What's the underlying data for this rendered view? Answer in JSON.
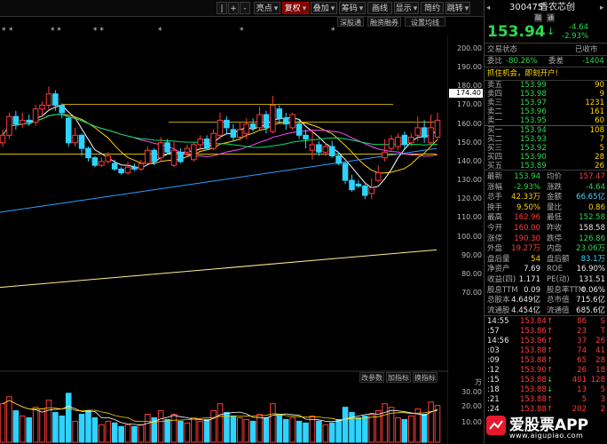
{
  "toolbar": {
    "left_icons": [
      "|",
      "+",
      "-"
    ],
    "buttons": [
      {
        "label": "亮点",
        "arrow": "▾",
        "active": false
      },
      {
        "label": "复权",
        "arrow": "▾",
        "active": true
      },
      {
        "label": "叠加",
        "arrow": "▾",
        "active": false
      },
      {
        "label": "筹码",
        "arrow": "▾",
        "active": false
      },
      {
        "label": "画线",
        "arrow": "",
        "active": false
      },
      {
        "label": "显示",
        "arrow": "▾",
        "active": false
      },
      {
        "label": "简约",
        "arrow": "",
        "active": false
      },
      {
        "label": "跳转",
        "arrow": "▾",
        "active": false
      }
    ],
    "sub_buttons": [
      "深股通",
      "融资融券",
      "设置均线"
    ]
  },
  "chart": {
    "price_axis_labels": [
      "200.00",
      "190.00",
      "180.00",
      "170.00",
      "160.00",
      "150.00",
      "140.00",
      "130.00",
      "120.00",
      "110.00",
      "100.00",
      "90.00",
      "80.00",
      "70.00"
    ],
    "current_price_tag": "174.40",
    "volume_toolbar": [
      "改参数",
      "加指标",
      "换指标"
    ],
    "volume_axis_labels": [
      "万",
      "30.00",
      "20.00",
      "10.00"
    ],
    "colors": {
      "up": "#ff3b3b",
      "down": "#2fd3ff",
      "ma5": "#ffffff",
      "ma10": "#ffd400",
      "ma20": "#ff4cff",
      "ma60": "#00e36a",
      "ma120": "#2aa0ff",
      "ma250": "#fff08a"
    }
  },
  "chart_data": {
    "type": "candlestick",
    "ylim": [
      70,
      200
    ],
    "candles": [
      {
        "o": 150,
        "c": 154,
        "h": 157,
        "l": 148
      },
      {
        "o": 154,
        "c": 164,
        "h": 166,
        "l": 152
      },
      {
        "o": 164,
        "c": 160,
        "h": 167,
        "l": 157
      },
      {
        "o": 160,
        "c": 162,
        "h": 166,
        "l": 158
      },
      {
        "o": 162,
        "c": 161,
        "h": 165,
        "l": 159
      },
      {
        "o": 161,
        "c": 168,
        "h": 170,
        "l": 159
      },
      {
        "o": 168,
        "c": 170,
        "h": 172,
        "l": 164
      },
      {
        "o": 170,
        "c": 176,
        "h": 180,
        "l": 168
      },
      {
        "o": 176,
        "c": 170,
        "h": 178,
        "l": 167
      },
      {
        "o": 170,
        "c": 166,
        "h": 171,
        "l": 163
      },
      {
        "o": 163,
        "c": 150,
        "h": 164,
        "l": 148
      },
      {
        "o": 150,
        "c": 154,
        "h": 158,
        "l": 148
      },
      {
        "o": 154,
        "c": 147,
        "h": 155,
        "l": 143
      },
      {
        "o": 147,
        "c": 142,
        "h": 148,
        "l": 140
      },
      {
        "o": 142,
        "c": 138,
        "h": 143,
        "l": 137
      },
      {
        "o": 138,
        "c": 140,
        "h": 142,
        "l": 137
      },
      {
        "o": 140,
        "c": 143,
        "h": 145,
        "l": 139
      },
      {
        "o": 139,
        "c": 136,
        "h": 141,
        "l": 135
      },
      {
        "o": 136,
        "c": 134,
        "h": 137,
        "l": 133
      },
      {
        "o": 134,
        "c": 137,
        "h": 140,
        "l": 133
      },
      {
        "o": 137,
        "c": 136,
        "h": 139,
        "l": 135
      },
      {
        "o": 136,
        "c": 139,
        "h": 141,
        "l": 135
      },
      {
        "o": 139,
        "c": 146,
        "h": 148,
        "l": 139
      },
      {
        "o": 146,
        "c": 140,
        "h": 147,
        "l": 138
      },
      {
        "o": 142,
        "c": 150,
        "h": 153,
        "l": 140
      },
      {
        "o": 150,
        "c": 145,
        "h": 152,
        "l": 144
      },
      {
        "o": 138,
        "c": 146,
        "h": 151,
        "l": 137
      },
      {
        "o": 145,
        "c": 140,
        "h": 147,
        "l": 139
      },
      {
        "o": 145,
        "c": 147,
        "h": 149,
        "l": 143
      },
      {
        "o": 141,
        "c": 149,
        "h": 150,
        "l": 140
      },
      {
        "o": 149,
        "c": 152,
        "h": 154,
        "l": 146
      },
      {
        "o": 152,
        "c": 147,
        "h": 154,
        "l": 146
      },
      {
        "o": 147,
        "c": 155,
        "h": 157,
        "l": 146
      },
      {
        "o": 154,
        "c": 162,
        "h": 166,
        "l": 152
      },
      {
        "o": 162,
        "c": 158,
        "h": 164,
        "l": 155
      },
      {
        "o": 157,
        "c": 153,
        "h": 160,
        "l": 151
      },
      {
        "o": 153,
        "c": 157,
        "h": 161,
        "l": 151
      },
      {
        "o": 155,
        "c": 160,
        "h": 163,
        "l": 152
      },
      {
        "o": 160,
        "c": 158,
        "h": 163,
        "l": 156
      },
      {
        "o": 158,
        "c": 165,
        "h": 169,
        "l": 157
      },
      {
        "o": 165,
        "c": 158,
        "h": 167,
        "l": 155
      },
      {
        "o": 156,
        "c": 170,
        "h": 175,
        "l": 155
      },
      {
        "o": 168,
        "c": 163,
        "h": 170,
        "l": 160
      },
      {
        "o": 163,
        "c": 160,
        "h": 166,
        "l": 157
      },
      {
        "o": 158,
        "c": 165,
        "h": 166,
        "l": 157
      },
      {
        "o": 160,
        "c": 154,
        "h": 162,
        "l": 152
      },
      {
        "o": 154,
        "c": 152,
        "h": 157,
        "l": 147
      },
      {
        "o": 146,
        "c": 149,
        "h": 157,
        "l": 141
      },
      {
        "o": 149,
        "c": 145,
        "h": 151,
        "l": 143
      },
      {
        "o": 145,
        "c": 148,
        "h": 150,
        "l": 143
      },
      {
        "o": 148,
        "c": 143,
        "h": 151,
        "l": 142
      },
      {
        "o": 143,
        "c": 139,
        "h": 145,
        "l": 138
      },
      {
        "o": 139,
        "c": 130,
        "h": 140,
        "l": 128
      },
      {
        "o": 130,
        "c": 125,
        "h": 133,
        "l": 124
      },
      {
        "o": 128,
        "c": 127,
        "h": 130,
        "l": 126
      },
      {
        "o": 127,
        "c": 122,
        "h": 128,
        "l": 120
      },
      {
        "o": 123,
        "c": 126,
        "h": 131,
        "l": 120
      },
      {
        "o": 130,
        "c": 134,
        "h": 138,
        "l": 129
      },
      {
        "o": 142,
        "c": 145,
        "h": 152,
        "l": 140
      },
      {
        "o": 147,
        "c": 152,
        "h": 154,
        "l": 145
      },
      {
        "o": 148,
        "c": 153,
        "h": 155,
        "l": 146
      },
      {
        "o": 154,
        "c": 149,
        "h": 156,
        "l": 147
      },
      {
        "o": 150,
        "c": 153,
        "h": 155,
        "l": 148
      },
      {
        "o": 154,
        "c": 158,
        "h": 164,
        "l": 151
      },
      {
        "o": 158,
        "c": 153,
        "h": 162,
        "l": 150
      },
      {
        "o": 150,
        "c": 158,
        "h": 165,
        "l": 149
      },
      {
        "o": 153,
        "c": 162,
        "h": 166,
        "l": 151
      }
    ],
    "volumes": [
      22,
      26,
      18,
      15,
      14,
      20,
      19,
      24,
      17,
      15,
      28,
      12,
      16,
      18,
      14,
      10,
      12,
      11,
      9,
      10,
      9,
      10,
      16,
      14,
      18,
      13,
      16,
      12,
      11,
      14,
      12,
      13,
      18,
      22,
      17,
      15,
      14,
      13,
      12,
      16,
      14,
      22,
      16,
      13,
      14,
      12,
      11,
      15,
      12,
      10,
      11,
      13,
      20,
      17,
      14,
      15,
      16,
      18,
      22,
      20,
      14,
      13,
      15,
      19,
      16,
      23,
      21
    ]
  },
  "quote": {
    "code": "300475",
    "name": "香农芯创",
    "badges": [
      "融",
      "通"
    ],
    "price": "153.94",
    "arrow": "↓",
    "change": "-4.64",
    "change_pct": "-2.93%",
    "section_title": "交易状态",
    "status": "已收市",
    "weibi_label": "委比",
    "weibi": "-80.26%",
    "weicha_label": "委差",
    "weicha": "-1404",
    "ad_text": "抓住机会，即刻开户!",
    "sells": [
      {
        "label": "卖五",
        "price": "153.99",
        "vol": "90"
      },
      {
        "label": "卖四",
        "price": "153.98",
        "vol": "9"
      },
      {
        "label": "卖三",
        "price": "153.97",
        "vol": "1231"
      },
      {
        "label": "卖二",
        "price": "153.96",
        "vol": "161"
      },
      {
        "label": "卖一",
        "price": "153.95",
        "vol": "60"
      }
    ],
    "buys": [
      {
        "label": "买一",
        "price": "153.94",
        "vol": "108"
      },
      {
        "label": "买二",
        "price": "153.93",
        "vol": "7"
      },
      {
        "label": "买三",
        "price": "153.92",
        "vol": "5"
      },
      {
        "label": "买四",
        "price": "153.90",
        "vol": "28"
      },
      {
        "label": "买五",
        "price": "153.89",
        "vol": "26"
      }
    ],
    "stats": [
      {
        "l1": "最新",
        "v1": "153.94",
        "c1": "green",
        "l2": "均价",
        "v2": "157.47",
        "c2": "red"
      },
      {
        "l1": "涨幅",
        "v1": "-2.93%",
        "c1": "green",
        "l2": "涨跌",
        "v2": "-4.64",
        "c2": "green"
      },
      {
        "l1": "总手",
        "v1": "42.33万",
        "c1": "yellow",
        "l2": "金额",
        "v2": "66.65亿",
        "c2": "cyan"
      },
      {
        "l1": "换手",
        "v1": "9.50%",
        "c1": "yellow",
        "l2": "量比",
        "v2": "0.86",
        "c2": "yellow"
      },
      {
        "l1": "最高",
        "v1": "162.96",
        "c1": "red",
        "l2": "最低",
        "v2": "152.58",
        "c2": "green"
      },
      {
        "l1": "今开",
        "v1": "160.00",
        "c1": "red",
        "l2": "昨收",
        "v2": "158.58",
        "c2": "white"
      },
      {
        "l1": "涨停",
        "v1": "190.30",
        "c1": "red",
        "l2": "跌停",
        "v2": "126.86",
        "c2": "green"
      },
      {
        "l1": "外盘",
        "v1": "19.27万",
        "c1": "red",
        "l2": "内盘",
        "v2": "23.06万",
        "c2": "green"
      },
      {
        "l1": "盘后量",
        "v1": "54",
        "c1": "yellow",
        "l2": "盘后额",
        "v2": "83.1万",
        "c2": "cyan"
      },
      {
        "l1": "净资产",
        "v1": "7.69",
        "c1": "white",
        "l2": "ROE",
        "v2": "16.90%",
        "c2": "white"
      },
      {
        "l1": "收益(四)",
        "v1": "1.171",
        "c1": "white",
        "l2": "PE(动)",
        "v2": "131.51",
        "c2": "white"
      },
      {
        "l1": "股息TTM",
        "v1": "0.09",
        "c1": "white",
        "l2": "股息率TTM",
        "v2": "0.06%",
        "c2": "white"
      },
      {
        "l1": "总股本",
        "v1": "4.649亿",
        "c1": "white",
        "l2": "总市值",
        "v2": "715.6亿",
        "c2": "white"
      },
      {
        "l1": "流通股",
        "v1": "4.454亿",
        "c1": "white",
        "l2": "流通值",
        "v2": "685.6亿",
        "c2": "white"
      }
    ],
    "ticks": [
      {
        "time": "14:55",
        "price": "153.84",
        "dir": "↑",
        "vol": "86",
        "s": "S"
      },
      {
        "time": ":57",
        "price": "153.86",
        "dir": "↑",
        "vol": "23",
        "s": "T"
      },
      {
        "time": "14:56",
        "price": "153.86",
        "dir": "↑",
        "vol": "37",
        "s": "26"
      },
      {
        "time": ":03",
        "price": "153.88",
        "dir": "↑",
        "vol": "74",
        "s": "41"
      },
      {
        "time": ":09",
        "price": "153.88",
        "dir": "↑",
        "vol": "65",
        "s": "28"
      },
      {
        "time": ":12",
        "price": "153.90",
        "dir": "↑",
        "vol": "26",
        "s": "18"
      },
      {
        "time": ":15",
        "price": "153.88",
        "dir": "↓",
        "vol": "401",
        "s": "128"
      },
      {
        "time": ":18",
        "price": "153.88",
        "dir": "↓",
        "vol": "13",
        "s": "5"
      },
      {
        "time": ":21",
        "price": "153.88",
        "dir": "↑",
        "vol": "5",
        "s": "3"
      },
      {
        "time": ":24",
        "price": "153.88",
        "dir": "↑",
        "vol": "202",
        "s": "2"
      }
    ]
  },
  "watermark": {
    "title": "爱股票APP",
    "url": "www.aigupiao.com"
  }
}
